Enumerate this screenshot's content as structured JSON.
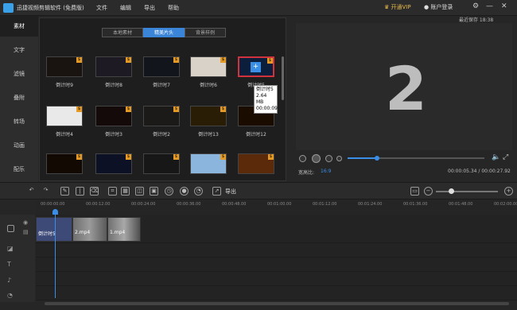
{
  "app": {
    "title": "迅捷视频剪辑软件 (免费版)",
    "menu": [
      "文件",
      "编辑",
      "导出",
      "帮助"
    ],
    "vip": "开通VIP",
    "login": "账户登录",
    "autosave": "最近保存 18:38"
  },
  "sidebar": {
    "items": [
      "素材",
      "文字",
      "滤镜",
      "叠附",
      "转场",
      "动画",
      "配乐"
    ],
    "active": 0
  },
  "media": {
    "tabs": [
      "本地素材",
      "精美片头",
      "背景样例"
    ],
    "active_tab": 1,
    "tiles": [
      {
        "label": "倒计时9",
        "bg": "#1a1410"
      },
      {
        "label": "倒计时8",
        "bg": "#1e1a24"
      },
      {
        "label": "倒计时7",
        "bg": "#12161c"
      },
      {
        "label": "倒计时6",
        "bg": "#d8d2c8"
      },
      {
        "label": "倒计时5",
        "bg": "#0b1e3c"
      },
      {
        "label": "倒计时4",
        "bg": "#e9e9e9"
      },
      {
        "label": "倒计时3",
        "bg": "#150a0a"
      },
      {
        "label": "倒计时2",
        "bg": "#1b1a18"
      },
      {
        "label": "倒计时13",
        "bg": "#2a1d06"
      },
      {
        "label": "倒计时12",
        "bg": "#1a0d00"
      },
      {
        "label": "",
        "bg": "#120a02"
      },
      {
        "label": "",
        "bg": "#0c1126"
      },
      {
        "label": "",
        "bg": "#171717"
      },
      {
        "label": "",
        "bg": "#8bb5dc"
      },
      {
        "label": "",
        "bg": "#5a2a0a"
      }
    ],
    "tooltip": [
      "倒计时5",
      "2.64 MB",
      "00:00:09"
    ]
  },
  "preview": {
    "number": "2"
  },
  "player": {
    "ratio_label": "宽高比:",
    "ratio_value": "16:9",
    "current": "00:00:05.34",
    "total": "00:00:27.92",
    "progress": 0.21
  },
  "toolbar": {
    "export_label": "导出"
  },
  "timeline": {
    "ticks": [
      "00:00:00.00",
      "00:00:12.00",
      "00:00:24.00",
      "00:00:36.00",
      "00:00:48.00",
      "00:01:00.00",
      "00:01:12.00",
      "00:01:24.00",
      "00:01:36.00",
      "00:01:48.00",
      "00:02:00.00"
    ],
    "clips": [
      {
        "label": "倒计时5"
      },
      {
        "label": "2.mp4"
      },
      {
        "label": "1.mp4"
      }
    ]
  }
}
